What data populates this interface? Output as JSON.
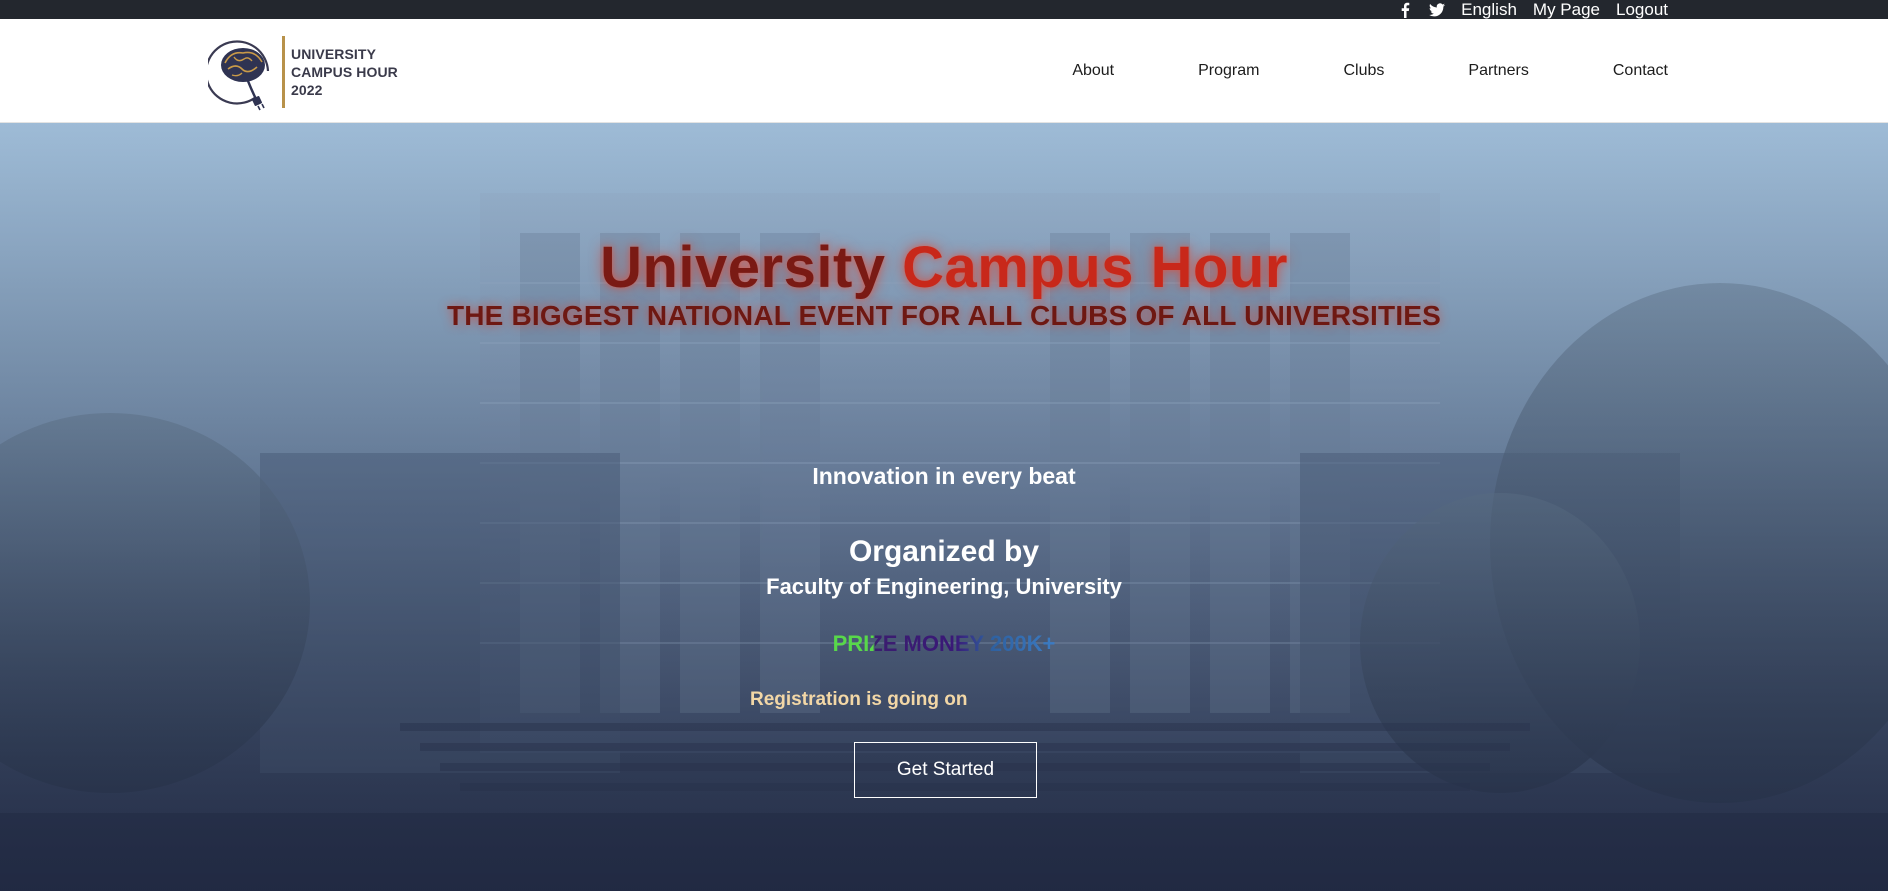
{
  "topbar": {
    "facebook_icon": "facebook-icon",
    "twitter_icon": "twitter-icon",
    "language": "English",
    "my_page": "My Page",
    "logout": "Logout"
  },
  "brand": {
    "line1": "UNIVERSITY",
    "line2": "CAMPUS HOUR",
    "line3": "2022",
    "logo_icon": "brain-plug-logo"
  },
  "nav": {
    "items": [
      {
        "label": "About"
      },
      {
        "label": "Program"
      },
      {
        "label": "Clubs"
      },
      {
        "label": "Partners"
      },
      {
        "label": "Contact"
      }
    ]
  },
  "hero": {
    "title_part1": "University ",
    "title_part2": "Campus Hour",
    "subtitle": "THE BIGGEST NATIONAL EVENT FOR ALL CLUBS OF ALL UNIVERSITIES",
    "tagline": "Innovation in every beat",
    "organized_heading": "Organized by",
    "organizer": "Faculty of Engineering, University",
    "prize": "PRIZE MONEY 200K+",
    "registration": "Registration is going on",
    "cta_label": "Get Started"
  },
  "colors": {
    "topbar_bg": "#23272e",
    "title_red": "#7a1a14",
    "title_glow": "#dc3c28",
    "registration_gold": "#f2d7a6",
    "logo_gold": "#b8924a"
  }
}
